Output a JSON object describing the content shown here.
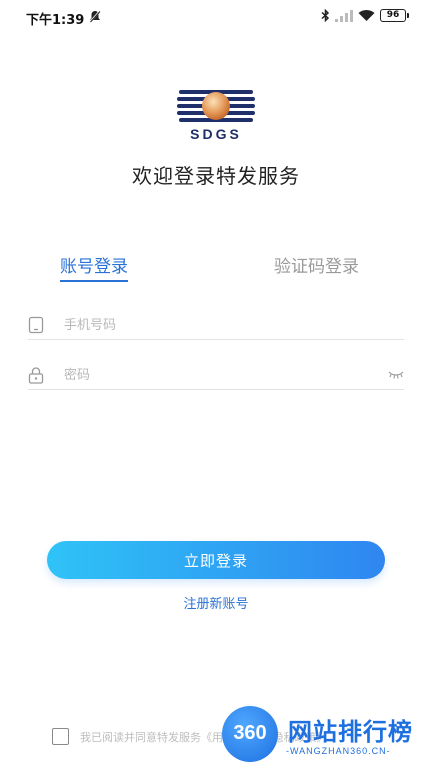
{
  "status_bar": {
    "time": "下午1:39",
    "battery": "96",
    "icons": [
      "do-not-disturb-icon",
      "bluetooth-icon",
      "signal-icon",
      "wifi-icon",
      "battery-icon"
    ]
  },
  "logo": {
    "text": "SDGS"
  },
  "welcome": "欢迎登录特发服务",
  "tabs": [
    {
      "label": "账号登录",
      "active": true
    },
    {
      "label": "验证码登录",
      "active": false
    }
  ],
  "fields": {
    "phone": {
      "placeholder": "手机号码",
      "value": ""
    },
    "password": {
      "placeholder": "密码",
      "value": ""
    }
  },
  "login_button": "立即登录",
  "register_link": "注册新账号",
  "agreement": {
    "text": "我已阅读并同意特发服务《用户协议》《隐私政策》",
    "checked": false
  },
  "watermark": {
    "number": "360",
    "title": "网站排行榜",
    "subtitle": "-WANGZHAN360.CN-"
  },
  "colors": {
    "accent": "#2a73d6",
    "gradient_start": "#2fc3f7",
    "gradient_end": "#2f86f0"
  }
}
